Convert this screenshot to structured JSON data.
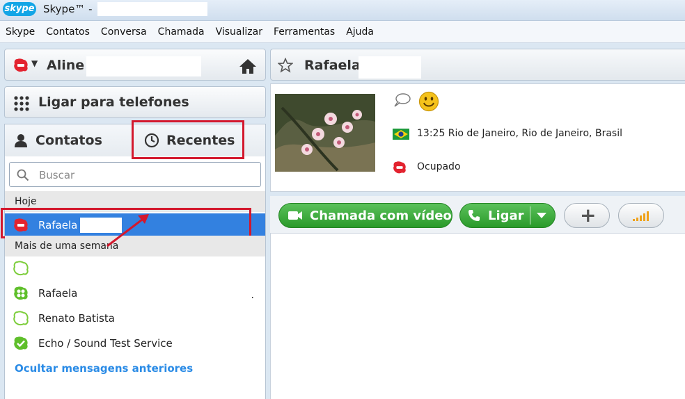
{
  "window": {
    "logo_text": "skype",
    "title": "Skype™ -"
  },
  "menu": [
    "Skype",
    "Contatos",
    "Conversa",
    "Chamada",
    "Visualizar",
    "Ferramentas",
    "Ajuda"
  ],
  "profile": {
    "name": "Aline"
  },
  "call_phones": {
    "label": "Ligar para telefones"
  },
  "tabs": {
    "contacts": "Contatos",
    "recent": "Recentes"
  },
  "search": {
    "placeholder": "Buscar"
  },
  "sections": {
    "today": "Hoje",
    "older": "Mais de uma semana"
  },
  "recent_today": [
    {
      "name": "Rafaela",
      "status": "busy"
    }
  ],
  "recent_older": [
    {
      "name": "",
      "status": "offline"
    },
    {
      "name": "Rafaela",
      "status": "online-group",
      "trailing": "."
    },
    {
      "name": "Renato Batista",
      "status": "offline"
    },
    {
      "name": "Echo / Sound Test Service",
      "status": "online"
    }
  ],
  "hide_link": "Ocultar mensagens anteriores",
  "contact": {
    "name": "Rafaela",
    "location": "13:25 Rio de Janeiro, Rio de Janeiro, Brasil",
    "status": "Ocupado"
  },
  "actions": {
    "video_call": "Chamada com vídeo",
    "call": "Ligar"
  },
  "colors": {
    "skype_blue": "#12a5e6",
    "selected_row": "#3381e0",
    "highlight_red": "#d3182d",
    "green_button": "#2a9a2a",
    "link": "#2a8be6"
  },
  "icons": [
    "skype-logo-icon",
    "busy-status-icon",
    "home-icon",
    "dialpad-icon",
    "contacts-person-icon",
    "clock-icon",
    "search-icon",
    "star-icon",
    "mood-message-icon",
    "smiley-icon",
    "brazil-flag-icon",
    "video-camera-icon",
    "phone-icon",
    "plus-icon",
    "call-quality-icon"
  ]
}
